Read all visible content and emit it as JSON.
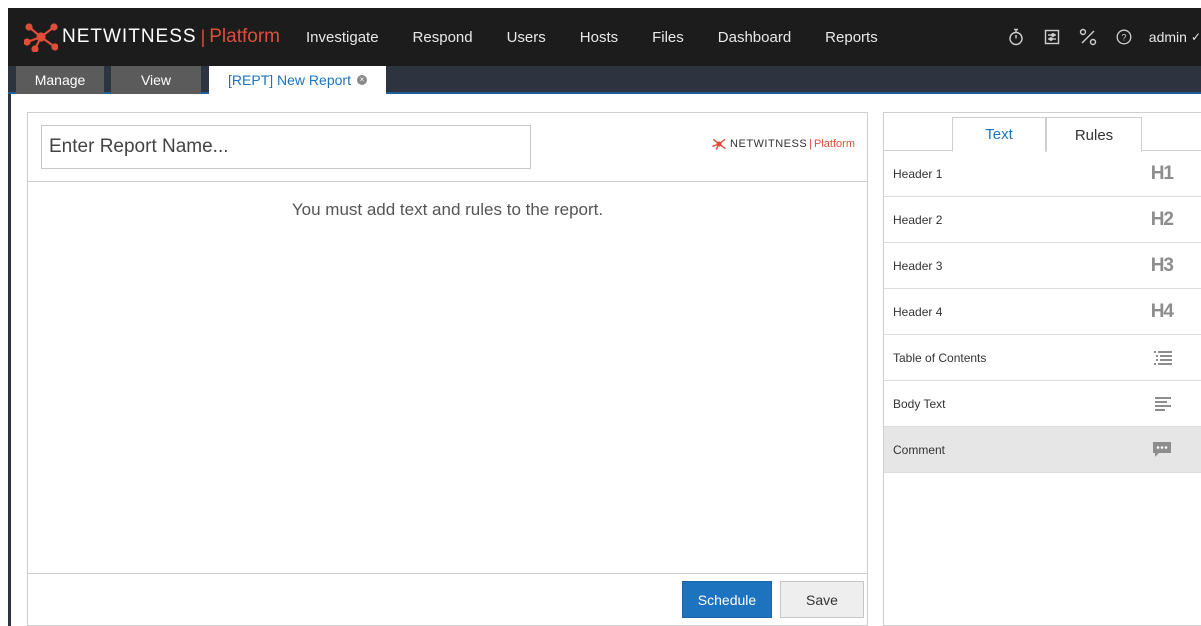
{
  "brand": {
    "name": "NETWITNESS",
    "separator": "|",
    "product": "Platform",
    "accent_color": "#e04e39"
  },
  "nav": {
    "items": [
      "Investigate",
      "Respond",
      "Users",
      "Hosts",
      "Files",
      "Dashboard",
      "Reports"
    ]
  },
  "toolbar": {
    "icons": [
      "timer-icon",
      "jobs-icon",
      "tools-icon",
      "help-icon"
    ],
    "user": "admin"
  },
  "tabs": {
    "manage": "Manage",
    "view": "View",
    "active": "[REPT] New Report"
  },
  "report": {
    "name_placeholder": "Enter Report Name...",
    "empty_message": "You must add text and rules to the report.",
    "schedule_label": "Schedule",
    "save_label": "Save",
    "primary_color": "#1e73be"
  },
  "palette": {
    "tab_text": "Text",
    "tab_rules": "Rules",
    "items": [
      {
        "label": "Header 1",
        "icon": "H1"
      },
      {
        "label": "Header 2",
        "icon": "H2"
      },
      {
        "label": "Header 3",
        "icon": "H3"
      },
      {
        "label": "Header 4",
        "icon": "H4"
      },
      {
        "label": "Table of Contents",
        "icon": "toc-icon"
      },
      {
        "label": "Body Text",
        "icon": "body-text-icon"
      },
      {
        "label": "Comment",
        "icon": "comment-icon"
      }
    ]
  }
}
